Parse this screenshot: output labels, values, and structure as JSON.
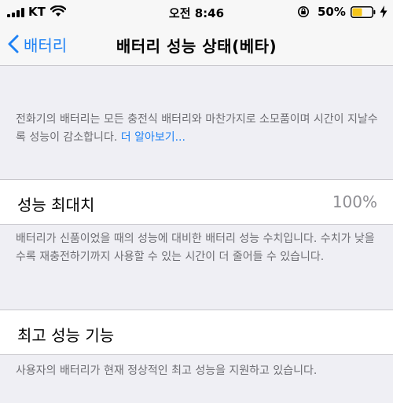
{
  "status_bar": {
    "carrier": "KT",
    "time": "오전 8:46",
    "battery_percent": "50%",
    "battery_level": 0.5
  },
  "nav": {
    "back_label": "배터리",
    "title": "배터리 성능 상태(베타)"
  },
  "intro": {
    "text": "전화기의 배터리는 모든 충전식 배터리와 마찬가지로 소모품이며 시간이 지날수록 성능이 감소합니다. ",
    "link": "더 알아보기..."
  },
  "max_capacity": {
    "label": "성능 최대치",
    "value": "100%",
    "footer": "배터리가 신품이었을 때의 성능에 대비한 배터리 성능 수치입니다. 수치가 낮을수록 재충전하기까지 사용할 수 있는 시간이 더 줄어들 수 있습니다."
  },
  "peak_performance": {
    "label": "최고 성능 기능",
    "footer": "사용자의 배터리가 현재 정상적인 최고 성능을 지원하고 있습니다."
  },
  "colors": {
    "accent": "#1f82f5",
    "background": "#efeff4",
    "battery_fill": "#f5c518"
  }
}
